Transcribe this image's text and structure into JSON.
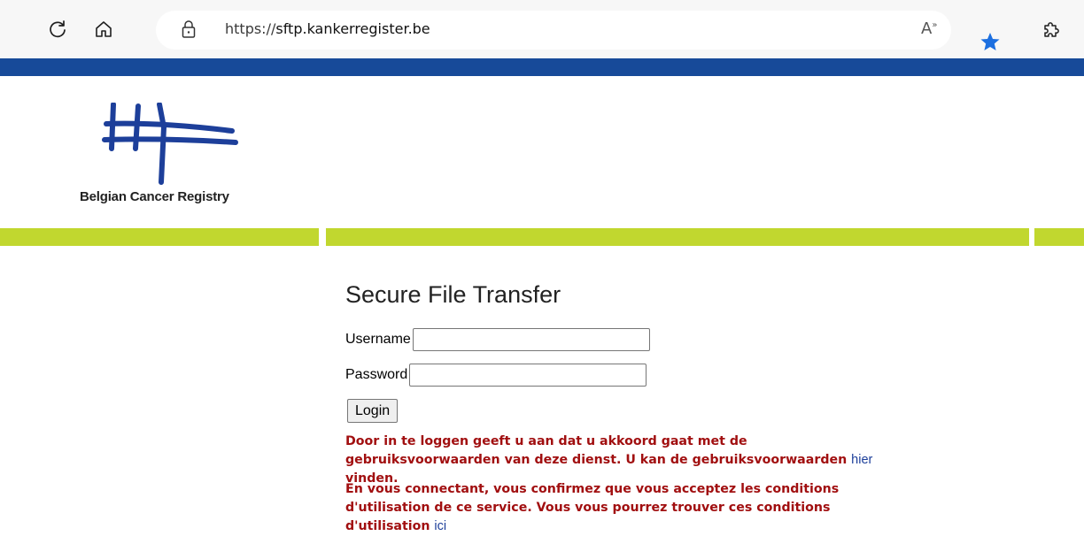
{
  "browser": {
    "url_scheme": "https://",
    "url_host": "sftp.kankerregister.be",
    "readaloud_label": "A",
    "readaloud_sup": "»"
  },
  "logo": {
    "text": "Belgian Cancer Registry"
  },
  "colors": {
    "blue_bar": "#174a99",
    "green_bar": "#c1d72f",
    "notice_text": "#a10f10",
    "link": "#1d3f9a"
  },
  "login": {
    "title": "Secure File Transfer",
    "username_label": "Username",
    "username_value": "",
    "password_label": "Password",
    "password_value": "",
    "login_button": "Login"
  },
  "notices": {
    "nl_text": "Door in te loggen geeft u aan dat u akkoord gaat met de gebruiksvoorwaarden van deze dienst. U kan de gebruiksvoorwaarden ",
    "nl_link": "hier",
    "nl_tail": " vinden.",
    "fr_text": "En vous connectant, vous confirmez que vous acceptez les conditions d'utilisation de ce service. Vous vous pourrez trouver ces conditions d'utilisation ",
    "fr_link": "ici"
  }
}
